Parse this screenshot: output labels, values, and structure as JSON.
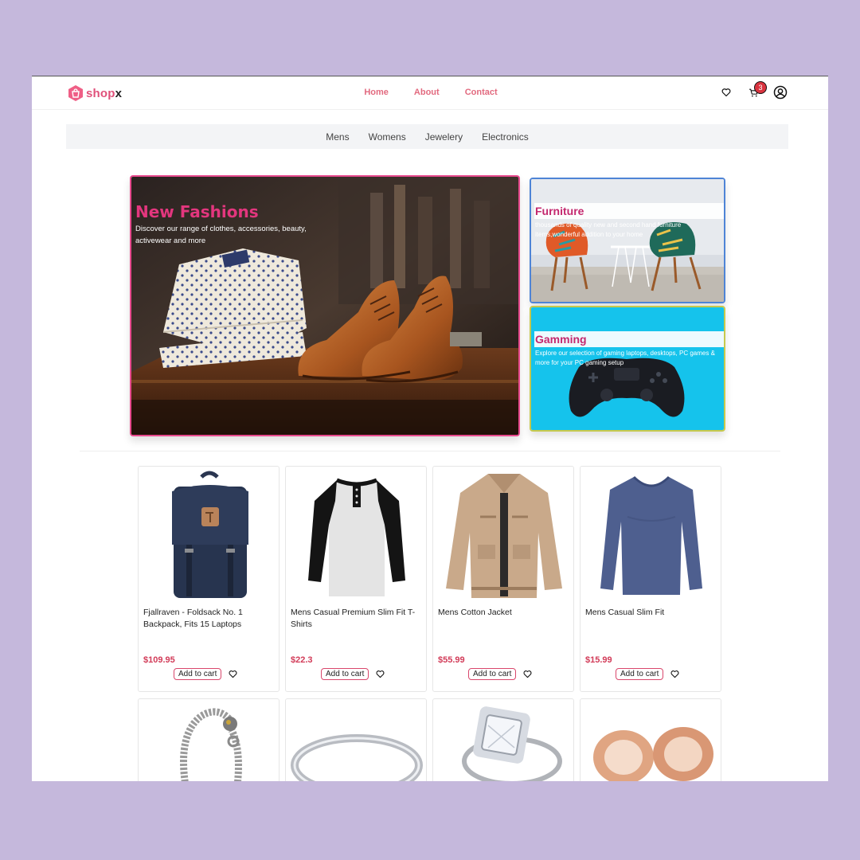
{
  "brand": {
    "name_main": "shop",
    "name_accent": "x"
  },
  "nav": [
    {
      "label": "Home"
    },
    {
      "label": "About"
    },
    {
      "label": "Contact"
    }
  ],
  "header": {
    "cart_count": "3"
  },
  "categories": [
    {
      "label": "Mens"
    },
    {
      "label": "Womens"
    },
    {
      "label": "Jewelery"
    },
    {
      "label": "Electronics"
    }
  ],
  "hero": {
    "main": {
      "title": "New Fashions",
      "description": "Discover our range of clothes, accessories, beauty, activewear and more"
    },
    "furniture": {
      "title": "Furniture",
      "description": "thousands of quality new and second hand furniture items,wonderful addition to your home"
    },
    "gaming": {
      "title": "Gamming",
      "description": "Explore our selection of gaming laptops, desktops, PC games & more for your PC gaming setup"
    }
  },
  "products": [
    {
      "title": "Fjallraven - Foldsack No. 1 Backpack, Fits 15 Laptops",
      "price": "$109.95",
      "cart_label": "Add to cart",
      "image": "backpack"
    },
    {
      "title": "Mens Casual Premium Slim Fit T-Shirts",
      "price": "$22.3",
      "cart_label": "Add to cart",
      "image": "raglan-shirt"
    },
    {
      "title": "Mens Cotton Jacket",
      "price": "$55.99",
      "cart_label": "Add to cart",
      "image": "jacket"
    },
    {
      "title": "Mens Casual Slim Fit",
      "price": "$15.99",
      "cart_label": "Add to cart",
      "image": "longsleeve"
    }
  ],
  "colors": {
    "accent": "#e3367e",
    "nav_link": "#e26a7f",
    "price": "#d23b58",
    "badge": "#d9333f",
    "page_bg": "#c5b8dc"
  }
}
